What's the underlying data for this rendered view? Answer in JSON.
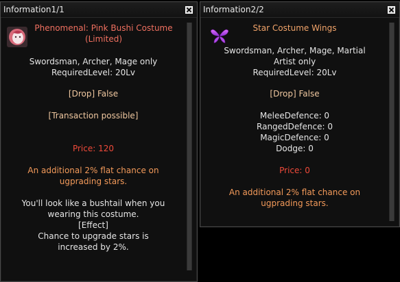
{
  "window1": {
    "title": "Information1/1",
    "item_icon": "pink-bushi-costume-icon",
    "item_name_line1": "Phenomenal: Pink Bushi Costume",
    "item_name_line2": "(Limited)",
    "class_restriction": "Swordsman, Archer, Mage only",
    "required_level": "RequiredLevel: 20Lv",
    "drop": "[Drop] False",
    "transaction": "[Transaction possible]",
    "price": "Price: 120",
    "bonus_line1": "An additional 2% flat chance on",
    "bonus_line2": "ugprading stars.",
    "desc_line1": "You'll look like a bushtail when you",
    "desc_line2": "wearing this costume.",
    "desc_line3": "[Effect]",
    "desc_line4": "Chance to upgrade stars is",
    "desc_line5": "increased by 2%."
  },
  "window2": {
    "title": "Information2/2",
    "item_icon": "butterfly-wings-icon",
    "item_name": "Star Costume Wings",
    "class_restriction_line1": "Swordsman, Archer, Mage, Martial",
    "class_restriction_line2": "Artist only",
    "required_level": "RequiredLevel: 20Lv",
    "drop": "[Drop] False",
    "melee_defence": "MeleeDefence: 0",
    "ranged_defence": "RangedDefence: 0",
    "magic_defence": "MagicDefence: 0",
    "dodge": "Dodge: 0",
    "price": "Price: 0",
    "bonus_line1": "An additional 2% flat chance on",
    "bonus_line2": "ugprading stars."
  },
  "colors": {
    "background": "#000000",
    "panel": "#101010",
    "white_text": "#e6e6e6",
    "orange_text": "#f39a5a",
    "price_red": "#f04a3a",
    "item_name_red": "#f07060"
  },
  "icons": {
    "close": "close-x-icon"
  }
}
